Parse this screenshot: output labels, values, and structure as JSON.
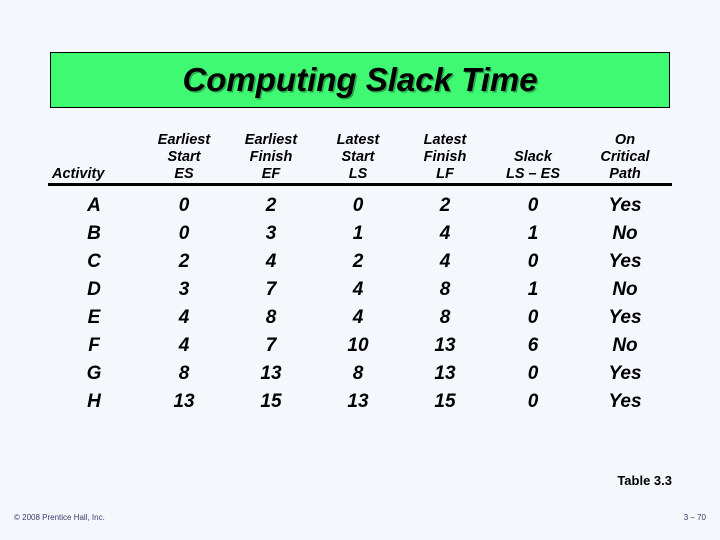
{
  "slide": {
    "background_color": "#f4f8fd",
    "title": "Computing Slack Time",
    "title_background_color": "#3ef971",
    "title_text_color": "#000000"
  },
  "table": {
    "caption": "Table 3.3",
    "headers": [
      {
        "line1": "",
        "line2": "",
        "line3": "Activity"
      },
      {
        "line1": "Earliest",
        "line2": "Start",
        "line3": "ES"
      },
      {
        "line1": "Earliest",
        "line2": "Finish",
        "line3": "EF"
      },
      {
        "line1": "Latest",
        "line2": "Start",
        "line3": "LS"
      },
      {
        "line1": "Latest",
        "line2": "Finish",
        "line3": "LF"
      },
      {
        "line1": "",
        "line2": "Slack",
        "line3": "LS – ES"
      },
      {
        "line1": "On",
        "line2": "Critical",
        "line3": "Path"
      }
    ],
    "rows": [
      {
        "activity": "A",
        "es": "0",
        "ef": "2",
        "ls": "0",
        "lf": "2",
        "slack": "0",
        "critical": "Yes"
      },
      {
        "activity": "B",
        "es": "0",
        "ef": "3",
        "ls": "1",
        "lf": "4",
        "slack": "1",
        "critical": "No"
      },
      {
        "activity": "C",
        "es": "2",
        "ef": "4",
        "ls": "2",
        "lf": "4",
        "slack": "0",
        "critical": "Yes"
      },
      {
        "activity": "D",
        "es": "3",
        "ef": "7",
        "ls": "4",
        "lf": "8",
        "slack": "1",
        "critical": "No"
      },
      {
        "activity": "E",
        "es": "4",
        "ef": "8",
        "ls": "4",
        "lf": "8",
        "slack": "0",
        "critical": "Yes"
      },
      {
        "activity": "F",
        "es": "4",
        "ef": "7",
        "ls": "10",
        "lf": "13",
        "slack": "6",
        "critical": "No"
      },
      {
        "activity": "G",
        "es": "8",
        "ef": "13",
        "ls": "8",
        "lf": "13",
        "slack": "0",
        "critical": "Yes"
      },
      {
        "activity": "H",
        "es": "13",
        "ef": "15",
        "ls": "13",
        "lf": "15",
        "slack": "0",
        "critical": "Yes"
      }
    ]
  },
  "footer": {
    "copyright": "© 2008 Prentice Hall, Inc.",
    "page_number": "3 – 70"
  }
}
